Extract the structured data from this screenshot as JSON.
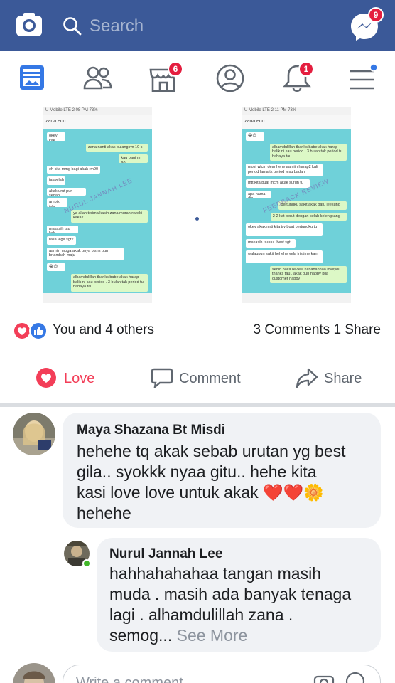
{
  "topbar": {
    "search_placeholder": "Search",
    "messenger_badge": "9",
    "bg": "#3b5998"
  },
  "nav": {
    "marketplace_badge": "6",
    "notifications_badge": "1"
  },
  "post": {
    "left_shot": {
      "status": "U Mobile LTE   2:08 PM   73%",
      "contact": "zana eco",
      "bubbles": [
        {
          "side": "in",
          "text": "okey kak"
        },
        {
          "side": "out",
          "text": "zana nanti akak pulang rm 10 k"
        },
        {
          "side": "out",
          "text": "kau bagi rm 90"
        },
        {
          "side": "in",
          "text": "eh kita mmg bagi akak rm90"
        },
        {
          "side": "in",
          "text": "takpelah"
        },
        {
          "side": "in",
          "text": "akak urut pun sedap"
        },
        {
          "side": "in",
          "text": "ambik jela"
        },
        {
          "side": "out",
          "text": "ya allah terima kasih zana murah rezeki kakak"
        },
        {
          "side": "in",
          "text": "makasih tau kak"
        },
        {
          "side": "in",
          "text": "rasa lega sgt2"
        },
        {
          "side": "in",
          "text": "aamiin moga akak pnya bisns pun brtambah maju"
        },
        {
          "side": "in",
          "text": "😂😍"
        },
        {
          "side": "out",
          "text": "alhamdulillah thanks babe akak harap balik ni kau period . 3 bulan tak period tu bahaya tau"
        }
      ],
      "watermark": "NURUL JANNAH LEE"
    },
    "right_shot": {
      "status": "U Mobile LTE   2:11 PM   73%",
      "contact": "zana eco",
      "bubbles": [
        {
          "side": "in",
          "text": "😂😍"
        },
        {
          "side": "out",
          "text": "alhamdulillah thanks babe akak harap balik ni kau period . 3 bulan tak period tu bahaya tau"
        },
        {
          "side": "in",
          "text": "most wlcm dear hehe aamiin harap2 kali period lama tk period tesu badan"
        },
        {
          "side": "in",
          "text": "mtt kita buat mcm akak suruh tu"
        },
        {
          "side": "in",
          "text": "apa nama dia"
        },
        {
          "side": "out",
          "text": "bertungku sakit akak batu leesung"
        },
        {
          "side": "out",
          "text": "2-2 kat perut dengan celah kelengkang"
        },
        {
          "side": "in",
          "text": "okey akak nnti kita try buat bertungku tu"
        },
        {
          "side": "in",
          "text": "makasih tauuu.. best sgt"
        },
        {
          "side": "in",
          "text": "walaupun sakit hehehe yela fristime kan"
        },
        {
          "side": "out",
          "text": "sedih baca review ni hahahhaa loveyou. thanks tau . akak pun happy bila customer happy"
        }
      ],
      "watermark": "FEEDBACK REVIEW"
    }
  },
  "reactions": {
    "summary": "You and 4 others",
    "counts": "3 Comments  1 Share"
  },
  "actions": {
    "love": "Love",
    "comment": "Comment",
    "share": "Share",
    "love_color": "#f33e58"
  },
  "comments": [
    {
      "name": "Maya Shazana Bt Misdi",
      "lines": [
        "hehehe tq akak sebab urutan yg best",
        "gila.. syokkk nyaa gitu.. hehe  kita",
        "kasi love love untuk akak ❤️❤️🌼",
        "hehehe"
      ]
    },
    {
      "name": "Nurul Jannah Lee",
      "lines": [
        "hahhahahahaa tangan masih",
        "muda . masih ada banyak tenaga",
        "lagi . alhamdulillah zana ."
      ],
      "last_line": "semog...",
      "see_more": "See More"
    }
  ],
  "composer": {
    "placeholder": "Write a comment..."
  }
}
